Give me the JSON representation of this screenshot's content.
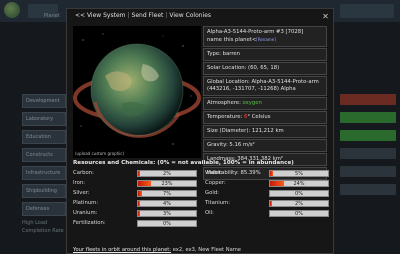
{
  "background": {
    "planet_label": "Planet",
    "left_items": [
      "Development",
      "Laboratory",
      "Education",
      "Constructs",
      "Infrastructure",
      "Shipbuilding",
      "Defenses"
    ],
    "left_footer": [
      "High Load",
      "Completion Rate"
    ]
  },
  "modal": {
    "nav": {
      "view_system": "<< View System",
      "send_fleet": "Send Fleet",
      "view_colonies": "View Colonies"
    },
    "image_caption": "(upload custom graphic)",
    "info": {
      "name_line": "Alpha-A3-5144-Proto-arm #3 [7028]",
      "rename_prefix": "name this planet<",
      "rename_link": "[Rename]",
      "type": "Type: barren",
      "solar_location": "Solar Location: (60, 65, 18)",
      "global_location": "Global Location: Alpha-A3-5144-Proto-arm (443216, -131707, -11268) Alpha",
      "atmosphere_label": "Atmosphere:",
      "atmosphere_value": "oxygen",
      "temperature_label": "Temperature:",
      "temperature_value": "6",
      "temperature_unit": "° Celsius",
      "size": "Size (Diameter): 121,212 km",
      "gravity": "Gravity: 5.16 m/s²",
      "landmass": "Landmass: 384,331,382 km²",
      "habitability": "Habitability: 85.39%"
    },
    "resources_title": "Resources and Chemicals: (0% = not available, 100% = in abundance)",
    "resources": [
      {
        "name": "Carbon:",
        "value": 2,
        "label": "2%"
      },
      {
        "name": "Water:",
        "value": 5,
        "label": "5%"
      },
      {
        "name": "Iron:",
        "value": 23,
        "label": "23%"
      },
      {
        "name": "Copper:",
        "value": 24,
        "label": "24%"
      },
      {
        "name": "Silver:",
        "value": 7,
        "label": "7%"
      },
      {
        "name": "Gold:",
        "value": 0,
        "label": "0%"
      },
      {
        "name": "Platinum:",
        "value": 4,
        "label": "4%"
      },
      {
        "name": "Titanium:",
        "value": 2,
        "label": "2%"
      },
      {
        "name": "Uranium:",
        "value": 3,
        "label": "3%"
      },
      {
        "name": "Oil:",
        "value": 0,
        "label": "0%"
      },
      {
        "name": "Fertilization:",
        "value": 0,
        "label": "0%"
      }
    ],
    "fleets_prefix": "Your fleets in orbit around this planet:",
    "fleets_list": "ex2, ex3, New Fleet Name"
  },
  "colors": {
    "accent_green": "#59c346",
    "accent_red": "#ff4a4a",
    "bar_fill": "#e8431a"
  }
}
